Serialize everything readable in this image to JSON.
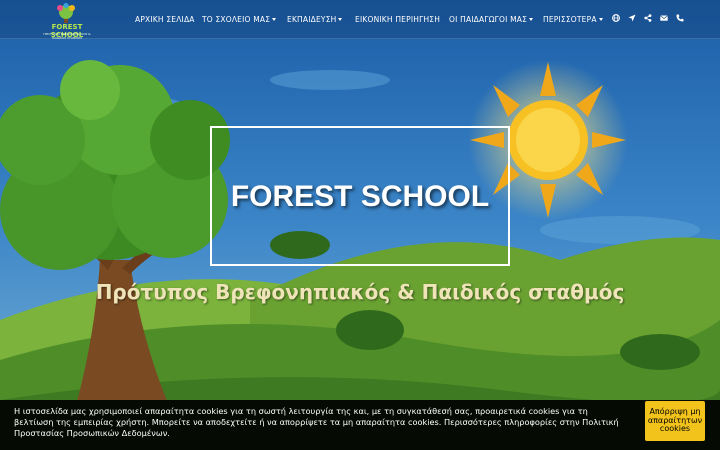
{
  "header": {
    "logo_text": "FOREST SCHOOL",
    "logo_subtext": "ΠΡΟΤΥΠΟΣ ΒΡΕΦΟΝΗΠΙΑΚΟΣ & ΠΑΙΔΙΚΟΣ ΣΤΑΘΜΟΣ"
  },
  "nav": {
    "items": [
      {
        "label": "ΑΡΧΙΚΗ ΣΕΛΙΔΑ",
        "dropdown": false
      },
      {
        "label": "ΤΟ ΣΧΟΛΕΙΟ ΜΑΣ",
        "dropdown": true
      },
      {
        "label": "ΕΚΠΑΙΔΕΥΣΗ",
        "dropdown": true
      },
      {
        "label": "ΕΙΚΟΝΙΚΗ ΠΕΡΙΗΓΗΣΗ",
        "dropdown": false
      },
      {
        "label": "ΟΙ ΠΑΙΔΑΓΩΓΟΙ ΜΑΣ",
        "dropdown": true
      },
      {
        "label": "ΠΕΡΙΣΣΟΤΕΡΑ",
        "dropdown": true
      }
    ],
    "icons": [
      "globe-icon",
      "location-arrow-icon",
      "share-icon",
      "envelope-icon",
      "phone-icon"
    ]
  },
  "hero": {
    "title": "FOREST SCHOOL",
    "subtitle": "Πρότυπος Βρεφονηπιακός & Παιδικός σταθμός"
  },
  "cookie_banner": {
    "text": "Η ιστοσελίδα μας χρησιμοποιεί απαραίτητα cookies για τη σωστή λειτουργία της και, με τη συγκατάθεσή σας, προαιρετικά cookies για τη βελτίωση της εμπειρίας χρήστη. Μπορείτε να αποδεχτείτε ή να απορρίψετε τα μη απαραίτητα cookies. Περισσότερες πληροφορίες στην Πολιτική Προστασίας Προσωπικών Δεδομένων.",
    "button_label": "Απόρριψη μη απαραίτητων cookies"
  },
  "colors": {
    "sky": "#2a6fb8",
    "sun": "#f5b81c",
    "grass": "#5b9a2c",
    "cookie_button": "#f2c31b"
  }
}
